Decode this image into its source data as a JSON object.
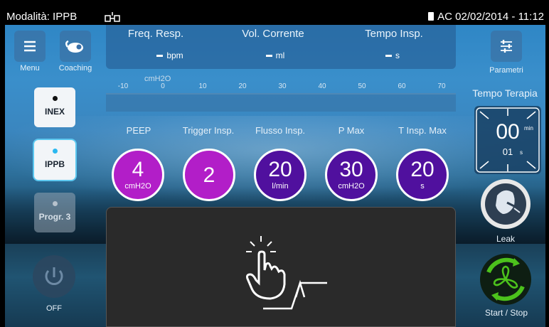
{
  "status_bar": {
    "mode": "Modalità: IPPB",
    "power_source": "AC",
    "datetime": "02/02/2014 - 11:12"
  },
  "left_panel": {
    "menu_label": "Menu",
    "coaching_label": "Coaching",
    "programs": [
      {
        "label": "INEX",
        "state": "inactive"
      },
      {
        "label": "IPPB",
        "state": "selected"
      },
      {
        "label": "Progr. 3",
        "state": "disabled"
      }
    ],
    "power_label": "OFF"
  },
  "monitor": {
    "items": [
      {
        "label": "Freq. Resp.",
        "value": "-",
        "unit": "bpm"
      },
      {
        "label": "Vol. Corrente",
        "value": "-",
        "unit": "ml"
      },
      {
        "label": "Tempo Insp.",
        "value": "-",
        "unit": "s"
      }
    ]
  },
  "pressure_scale": {
    "unit": "cmH2O",
    "ticks": [
      "-10",
      "0",
      "10",
      "20",
      "30",
      "40",
      "50",
      "60",
      "70"
    ]
  },
  "parameters": [
    {
      "label": "PEEP",
      "value": "4",
      "unit": "cmH2O",
      "color": "#b21ec8"
    },
    {
      "label": "Trigger Insp.",
      "value": "2",
      "unit": "",
      "color": "#b21ec8"
    },
    {
      "label": "Flusso Insp.",
      "value": "20",
      "unit": "l/min",
      "color": "#50109e"
    },
    {
      "label": "P Max",
      "value": "30",
      "unit": "cmH2O",
      "color": "#50109e"
    },
    {
      "label": "T Insp. Max",
      "value": "20",
      "unit": "s",
      "color": "#50109e"
    }
  ],
  "right_panel": {
    "parametri_label": "Parametri",
    "therapy_time_title": "Tempo Terapia",
    "timer_minutes": "00",
    "timer_minutes_unit": "min",
    "timer_seconds": "01",
    "timer_seconds_unit": "s",
    "leak_label": "Leak",
    "start_stop_label": "Start / Stop"
  },
  "icons": [
    "menu-icon",
    "coaching-icon",
    "power-icon",
    "sliders-icon",
    "network-icon",
    "battery-icon",
    "mask-leak-icon",
    "fan-icon",
    "tap-hand-icon",
    "trigger-curve-icon"
  ],
  "colors": {
    "accent_blue": "#2bb8f0",
    "start_green": "#4cc21c",
    "pink": "#b21ec8",
    "purple": "#50109e"
  }
}
